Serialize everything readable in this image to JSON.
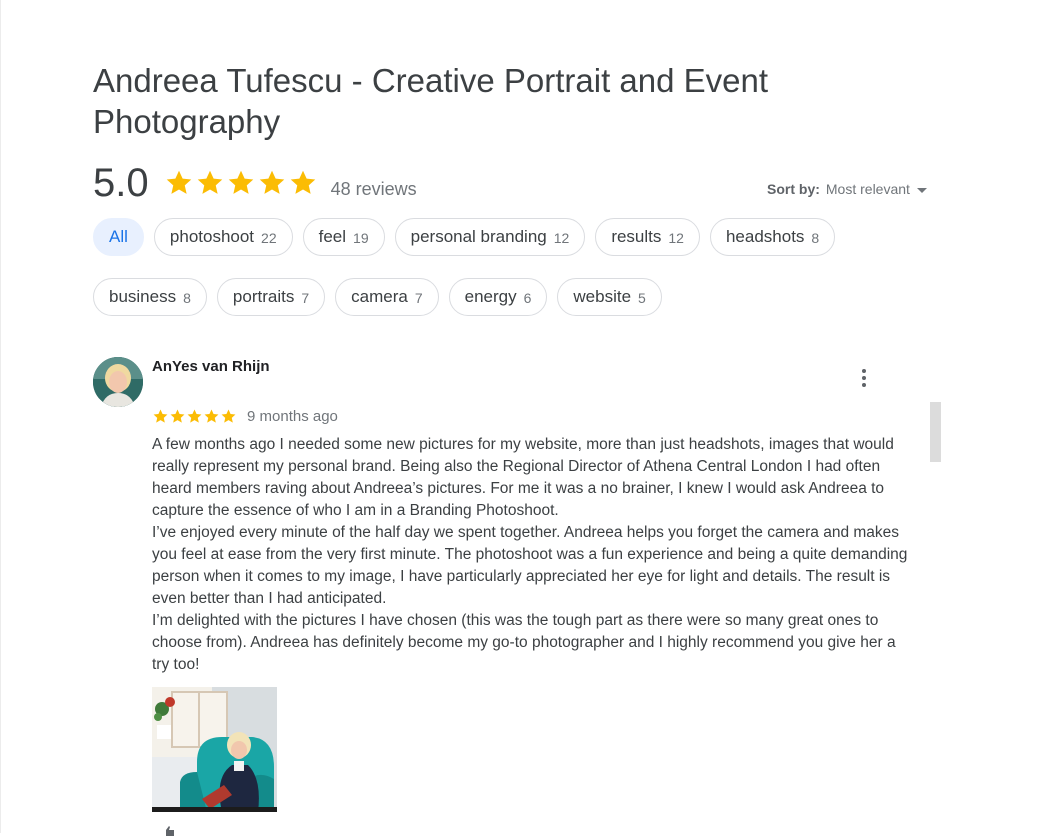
{
  "place": {
    "title": "Andreea Tufescu - Creative Portrait and Event Photography"
  },
  "summary": {
    "rating": "5.0",
    "stars": 5,
    "reviews_label": "48 reviews",
    "star_color": "#fbbc04"
  },
  "sort": {
    "label": "Sort by:",
    "value": "Most relevant"
  },
  "filters": {
    "row1": [
      {
        "label": "All",
        "count": "",
        "active": true
      },
      {
        "label": "photoshoot",
        "count": "22"
      },
      {
        "label": "feel",
        "count": "19"
      },
      {
        "label": "personal branding",
        "count": "12"
      },
      {
        "label": "results",
        "count": "12"
      },
      {
        "label": "headshots",
        "count": "8"
      }
    ],
    "row2": [
      {
        "label": "business",
        "count": "8"
      },
      {
        "label": "portraits",
        "count": "7"
      },
      {
        "label": "camera",
        "count": "7"
      },
      {
        "label": "energy",
        "count": "6"
      },
      {
        "label": "website",
        "count": "5"
      }
    ],
    "active_color": "#1a73e8"
  },
  "review": {
    "author": "AnYes van Rhijn",
    "stars": 5,
    "time": "9 months ago",
    "paragraphs": [
      "A few months ago I needed some new pictures for my website, more than just headshots, images that would really represent my personal brand. Being also the Regional Director of Athena Central London I had often heard members raving about Andreea’s pictures. For me it was a no brainer, I knew I would ask Andreea to capture the essence of who I am in a Branding Photoshoot.",
      "I’ve enjoyed every minute of the half day we spent together. Andreea helps you forget the camera and makes you feel at ease from the very first minute. The photoshoot was a fun experience and being a quite demanding person when it comes to my image, I have particularly appreciated her eye for light and details. The result is even better than I had anticipated.",
      "I’m delighted with the pictures I have chosen (this was the tough part as there were so many great ones to choose from). Andreea has definitely become my go-to photographer and I highly recommend you give her a try too!"
    ]
  },
  "icons": {
    "star": "star-icon",
    "more": "more-vert-icon",
    "caret": "caret-down-icon",
    "like": "thumb-up-icon"
  }
}
